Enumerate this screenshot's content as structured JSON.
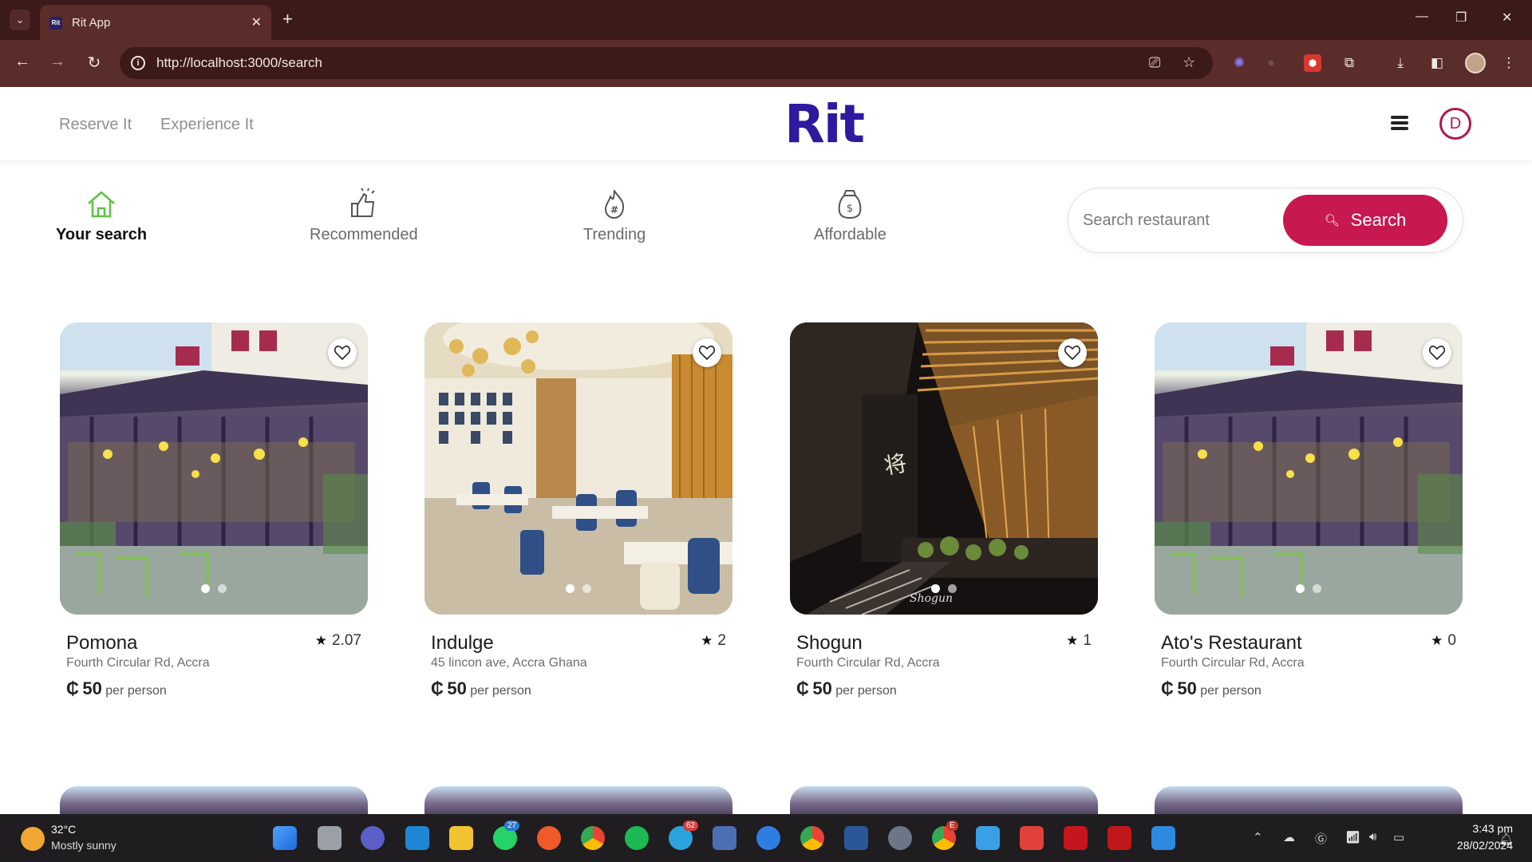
{
  "browser": {
    "tab_title": "Rit App",
    "url": "http://localhost:3000/search"
  },
  "header": {
    "nav_links": [
      "Reserve It",
      "Experience It"
    ],
    "logo": "Rit",
    "avatar_initial": "D"
  },
  "categories": [
    {
      "label": "Your search",
      "icon": "home-icon",
      "active": true
    },
    {
      "label": "Recommended",
      "icon": "thumbs-up-icon",
      "active": false
    },
    {
      "label": "Trending",
      "icon": "fire-hashtag-icon",
      "active": false
    },
    {
      "label": "Affordable",
      "icon": "money-bag-icon",
      "active": false
    }
  ],
  "search": {
    "placeholder": "Search restaurant",
    "button_label": "Search"
  },
  "restaurants": [
    {
      "name": "Pomona",
      "rating": "2.07",
      "address": "Fourth Circular Rd, Accra",
      "currency": "₵",
      "price": "50",
      "unit": "per person"
    },
    {
      "name": "Indulge",
      "rating": "2",
      "address": "45 lincon ave, Accra Ghana",
      "currency": "₵",
      "price": "50",
      "unit": "per person"
    },
    {
      "name": "Shogun",
      "rating": "1",
      "address": "Fourth Circular Rd, Accra",
      "currency": "₵",
      "price": "50",
      "unit": "per person"
    },
    {
      "name": "Ato's Restaurant",
      "rating": "0",
      "address": "Fourth Circular Rd, Accra",
      "currency": "₵",
      "price": "50",
      "unit": "per person"
    }
  ],
  "taskbar": {
    "weather_temp": "32°C",
    "weather_desc": "Mostly sunny",
    "time": "3:43 pm",
    "date": "28/02/2024",
    "badges": {
      "whatsapp": "27",
      "telegram": "62",
      "chrome_profile": "E"
    }
  },
  "colors": {
    "brand": "#2e1a9e",
    "accent": "#c7184f",
    "active_icon": "#5fc24a"
  }
}
